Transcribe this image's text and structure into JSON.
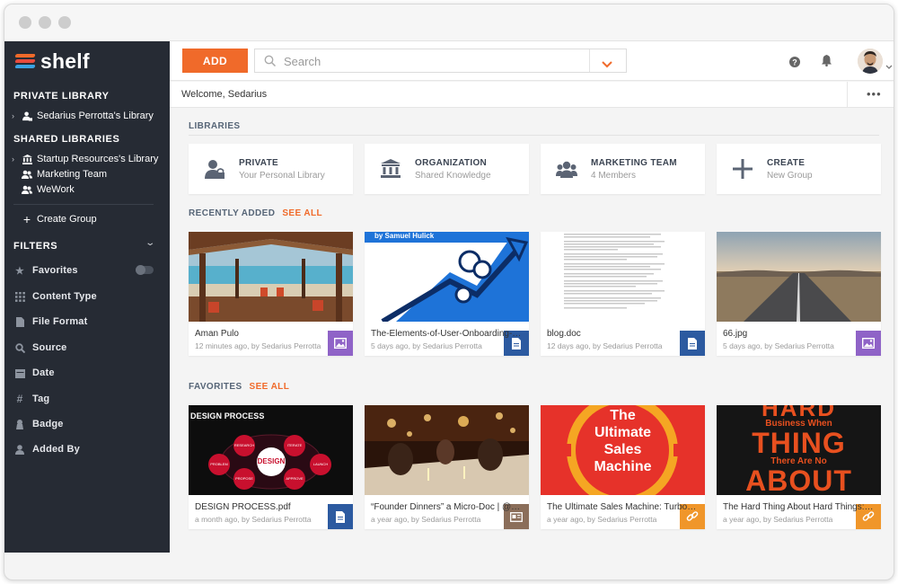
{
  "app": {
    "logo_text": "shelf"
  },
  "colors": {
    "accent": "#f06a2a",
    "sidebar": "#262b34",
    "purple_badge": "#8f63c7",
    "blue_badge": "#2c5aa0",
    "brown_badge": "#8b6e5a",
    "orange_badge": "#f0962a"
  },
  "sidebar": {
    "private_heading": "PRIVATE LIBRARY",
    "private_items": [
      {
        "label": "Sedarius Perrotta's Library",
        "icon": "user-lock-icon"
      }
    ],
    "shared_heading": "SHARED LIBRARIES",
    "shared_items": [
      {
        "label": "Startup Resources's Library",
        "icon": "bank-icon"
      },
      {
        "label": "Marketing Team",
        "icon": "group-icon"
      },
      {
        "label": "WeWork",
        "icon": "group-icon"
      }
    ],
    "create_group": "Create Group",
    "filters_heading": "FILTERS",
    "filters": [
      {
        "label": "Favorites",
        "icon": "star-icon"
      },
      {
        "label": "Content Type",
        "icon": "grid-icon"
      },
      {
        "label": "File Format",
        "icon": "file-icon"
      },
      {
        "label": "Source",
        "icon": "search-icon"
      },
      {
        "label": "Date",
        "icon": "calendar-icon"
      },
      {
        "label": "Tag",
        "icon": "hash-icon"
      },
      {
        "label": "Badge",
        "icon": "badge-icon"
      },
      {
        "label": "Added By",
        "icon": "user-icon"
      }
    ]
  },
  "toolbar": {
    "add_label": "ADD",
    "search_placeholder": "Search"
  },
  "welcome": "Welcome, Sedarius",
  "libraries": {
    "title": "LIBRARIES",
    "cards": [
      {
        "title": "PRIVATE",
        "subtitle": "Your Personal Library",
        "icon": "user-lock-icon"
      },
      {
        "title": "ORGANIZATION",
        "subtitle": "Shared Knowledge",
        "icon": "bank-icon"
      },
      {
        "title": "MARKETING TEAM",
        "subtitle": "4 Members",
        "icon": "group-icon"
      },
      {
        "title": "CREATE",
        "subtitle": "New Group",
        "icon": "plus-icon"
      }
    ]
  },
  "recent": {
    "title": "RECENTLY ADDED",
    "see_all": "SEE ALL",
    "items": [
      {
        "name": "Aman Pulo",
        "meta": "12 minutes ago, by Sedarius Perrotta",
        "badge": "image-icon"
      },
      {
        "name": "The-Elements-of-User-Onboarding-In...",
        "meta": "5 days ago, by Sedarius Perrotta",
        "badge": "document-icon",
        "thumb_text": "by Samuel Hulick"
      },
      {
        "name": "blog.doc",
        "meta": "12 days ago, by Sedarius Perrotta",
        "badge": "document-icon"
      },
      {
        "name": "66.jpg",
        "meta": "5 days ago, by Sedarius Perrotta",
        "badge": "image-icon"
      }
    ]
  },
  "favorites": {
    "title": "FAVORITES",
    "see_all": "SEE ALL",
    "items": [
      {
        "name": "DESIGN PROCESS.pdf",
        "meta": "a month ago, by Sedarius Perrotta",
        "badge": "document-icon",
        "thumb_title": "DESIGN PROCESS",
        "thumb_center": "DESIGN",
        "thumb_nodes": [
          "RESEARCH",
          "ITERATE",
          "PROBLEM",
          "LAUNCH",
          "PROPOSE",
          "APPROVE"
        ]
      },
      {
        "name": "“Founder Dinners” a Micro-Doc | @D...",
        "meta": "a year ago, by Sedarius Perrotta",
        "badge": "article-icon"
      },
      {
        "name": "The Ultimate Sales Machine: Turboch...",
        "meta": "a year ago, by Sedarius Perrotta",
        "badge": "link-icon",
        "thumb_lines": [
          "The",
          "Ultimate",
          "Sales",
          "Machine"
        ]
      },
      {
        "name": "The Hard Thing About Hard Things: B...",
        "meta": "a year ago, by Sedarius Perrotta",
        "badge": "link-icon",
        "thumb_lines": [
          "HARD",
          "Business When",
          "THING",
          "There Are No",
          "ABOUT"
        ]
      }
    ]
  }
}
